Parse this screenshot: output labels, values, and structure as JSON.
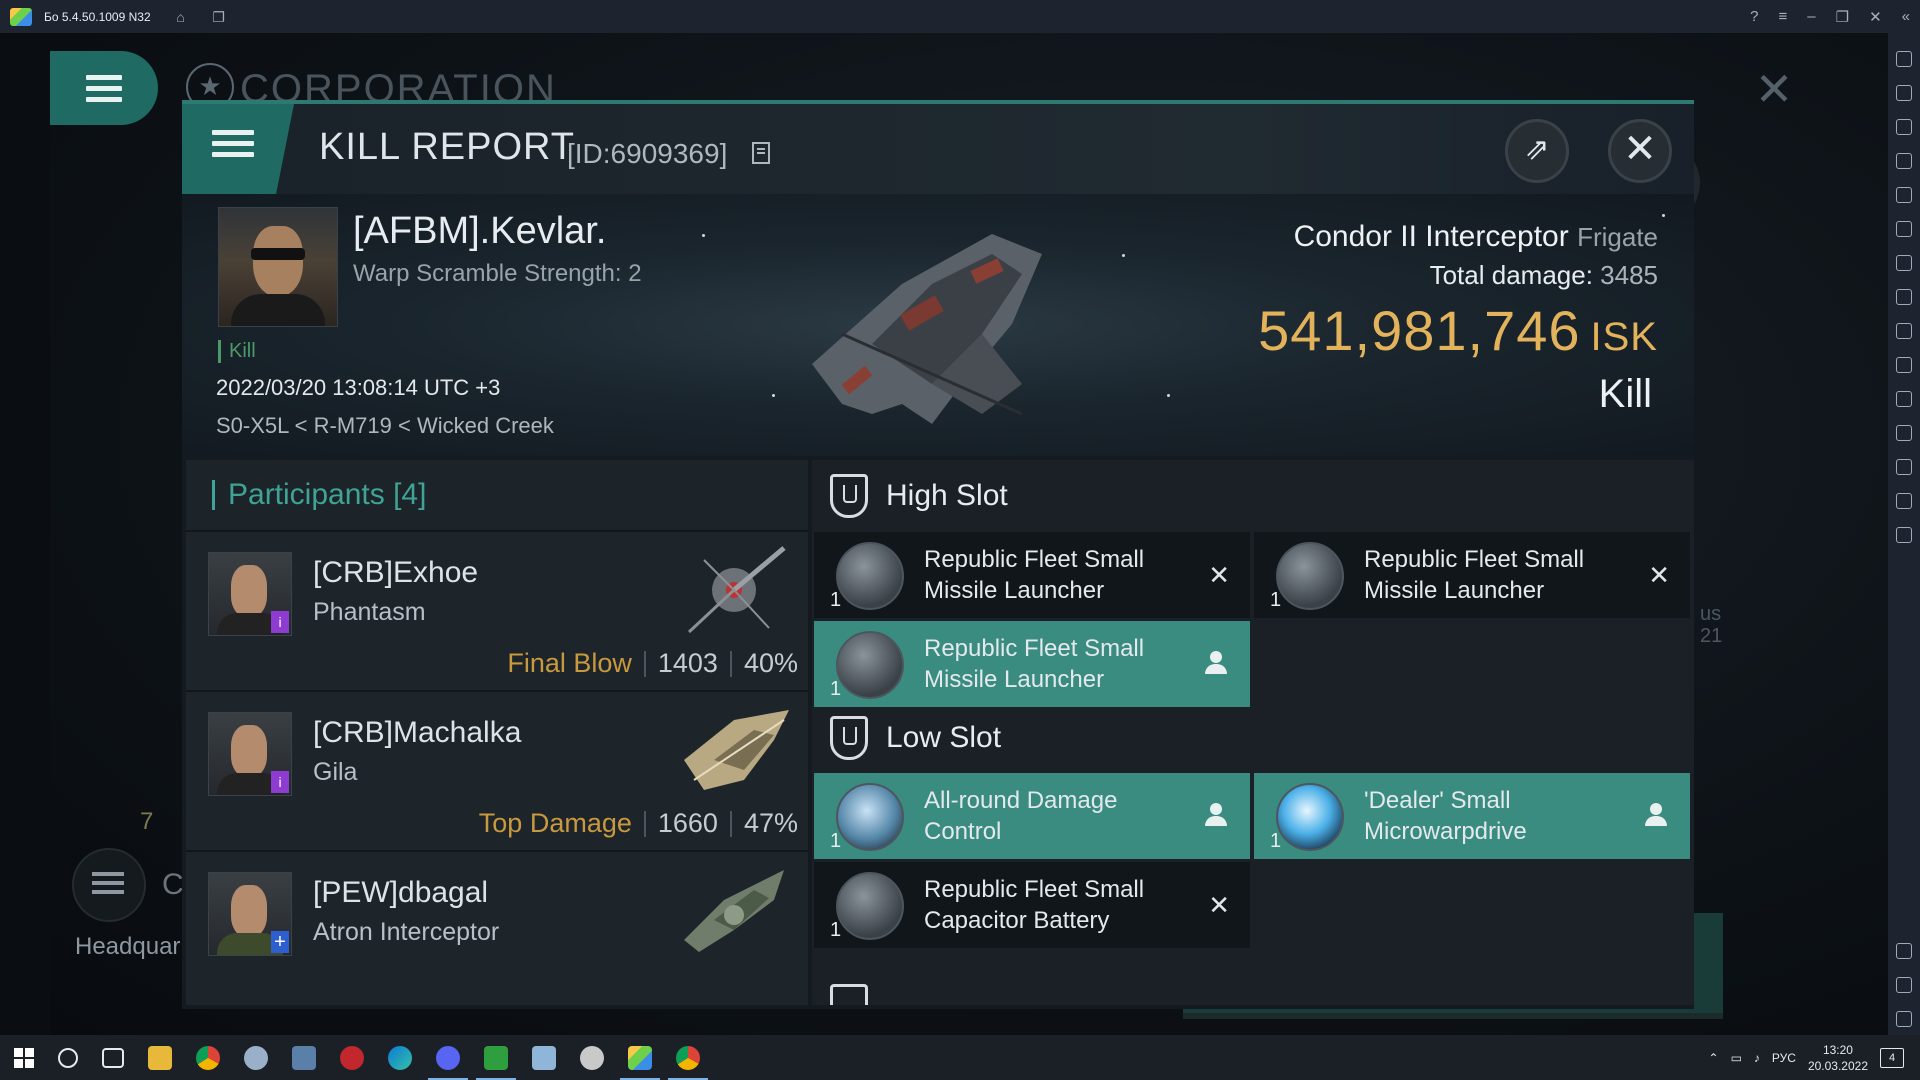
{
  "emulator": {
    "title": "Бо 5.4.50.1009 N32"
  },
  "background": {
    "section_title": "CORPORATION",
    "headquarters_label": "Headquar",
    "count_label": "7",
    "partial_label": "C",
    "right_partial_text": "us\n21"
  },
  "kill_report": {
    "title": "KILL REPORT",
    "id_label": "[ID:6909369]",
    "victim": {
      "name": "[AFBM].Kevlar.",
      "warp_scramble": "Warp Scramble Strength: 2",
      "kill_tag": "Kill",
      "datetime": "2022/03/20 13:08:14 UTC +3",
      "location": "S0-X5L < R-M719 < Wicked Creek",
      "ship_name": "Condor II Interceptor",
      "ship_class": "Frigate",
      "total_damage_label": "Total damage:",
      "total_damage": "3485",
      "isk_value": "541,981,746",
      "isk_unit": "ISK",
      "result": "Kill"
    },
    "participants": {
      "title": "Participants",
      "count": "[4]",
      "rows": [
        {
          "name": "[CRB]Exhoe",
          "ship": "Phantasm",
          "role": "Final Blow",
          "damage": "1403",
          "percent": "40%"
        },
        {
          "name": "[CRB]Machalka",
          "ship": "Gila",
          "role": "Top Damage",
          "damage": "1660",
          "percent": "47%"
        },
        {
          "name": "[PEW]dbagal",
          "ship": "Atron Interceptor",
          "role": "",
          "damage": "",
          "percent": ""
        }
      ]
    },
    "fitting": {
      "high_slot_title": "High Slot",
      "low_slot_title": "Low Slot",
      "high": [
        {
          "qty": "1",
          "name": "Republic Fleet Small Missile Launcher",
          "state": "destroyed",
          "icon": "missile-launcher-icon"
        },
        {
          "qty": "1",
          "name": "Republic Fleet Small Missile Launcher",
          "state": "destroyed",
          "icon": "missile-launcher-icon"
        },
        {
          "qty": "1",
          "name": "Republic Fleet Small Missile Launcher",
          "state": "dropped",
          "icon": "missile-launcher-icon"
        }
      ],
      "low": [
        {
          "qty": "1",
          "name": "All-round Damage Control",
          "state": "dropped",
          "icon": "damage-control-icon"
        },
        {
          "qty": "1",
          "name": "'Dealer' Small Microwarpdrive",
          "state": "dropped",
          "icon": "microwarpdrive-icon"
        },
        {
          "qty": "1",
          "name": "Republic Fleet Small Capacitor Battery",
          "state": "destroyed",
          "icon": "capacitor-battery-icon"
        }
      ],
      "destroyed_symbol": "✕"
    }
  },
  "taskbar": {
    "lang": "РУС",
    "time": "13:20",
    "date": "20.03.2022",
    "notifications": "4"
  }
}
